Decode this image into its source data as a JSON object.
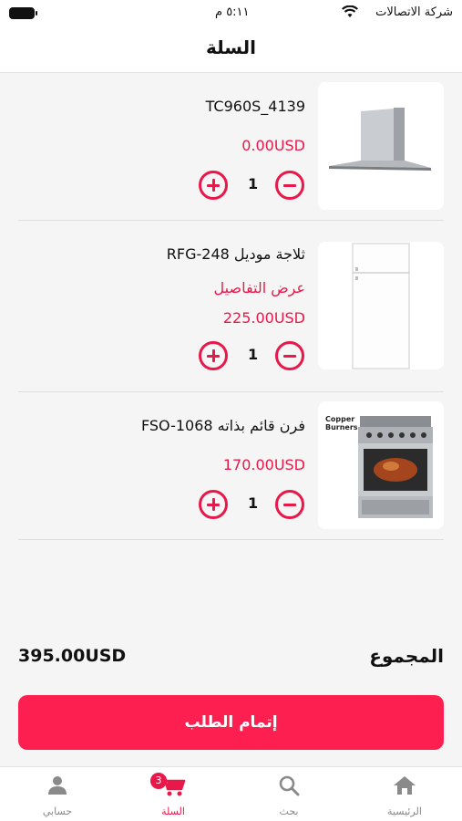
{
  "status_bar": {
    "carrier": "شركة الاتصالات",
    "time": "٥:١١ م"
  },
  "header": {
    "title": "السلة"
  },
  "cart": {
    "items": [
      {
        "name": "4139_TC960S",
        "price": "0.00USD",
        "quantity": "1"
      },
      {
        "name": "ثلاجة موديل RFG-248",
        "details_link": "عرض التفاصيل",
        "price": "225.00USD",
        "quantity": "1"
      },
      {
        "name": "فرن قائم بذاته FSO-1068",
        "price": "170.00USD",
        "quantity": "1",
        "image_text": [
          "Copper",
          "Burners"
        ]
      }
    ]
  },
  "summary": {
    "total_label": "المجموع",
    "total_value": "395.00USD"
  },
  "checkout": {
    "label": "إتمام الطلب"
  },
  "tab_bar": {
    "tabs": [
      {
        "label": "الرئيسية",
        "icon": "home-icon"
      },
      {
        "label": "بحث",
        "icon": "search-icon"
      },
      {
        "label": "السلة",
        "icon": "cart-icon",
        "badge": "3",
        "active": true
      },
      {
        "label": "حسابي",
        "icon": "user-icon"
      }
    ]
  },
  "colors": {
    "accent": "#e8194a",
    "button": "#fd1f4f"
  }
}
